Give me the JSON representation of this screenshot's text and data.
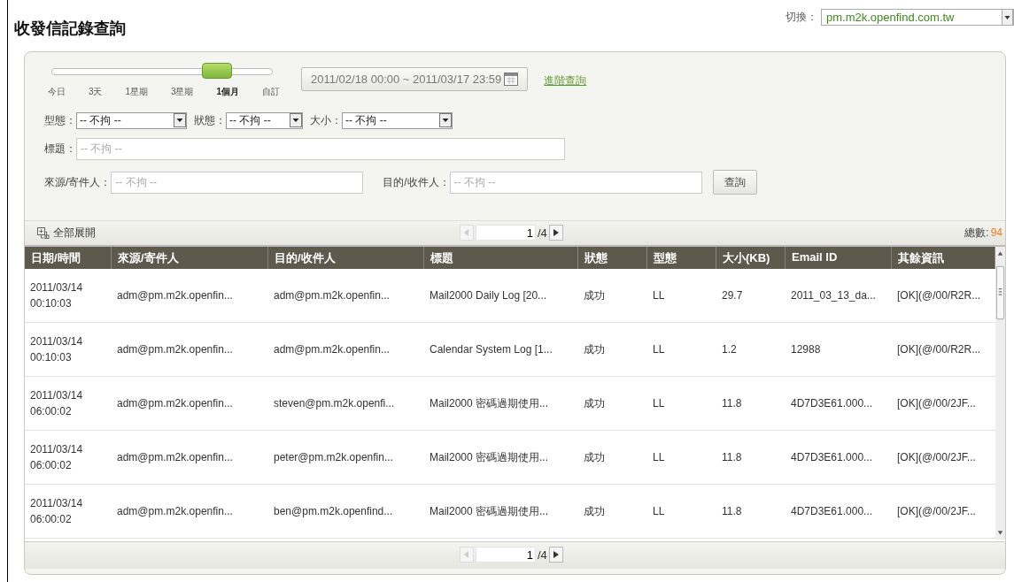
{
  "title": "收發信記錄查詢",
  "switcher": {
    "label": "切換：",
    "value": "pm.m2k.openfind.com.tw"
  },
  "range_slider": {
    "stops": [
      {
        "label": "今日",
        "selected": false
      },
      {
        "label": "3天",
        "selected": false
      },
      {
        "label": "1星期",
        "selected": false
      },
      {
        "label": "3星期",
        "selected": false
      },
      {
        "label": "1個月",
        "selected": true
      },
      {
        "label": "自訂",
        "selected": false
      }
    ]
  },
  "date_range": "2011/02/18 00:00 ~ 2011/03/17 23:59",
  "advanced_link": "進階查詢",
  "filters": [
    {
      "label": "型態：",
      "value": "-- 不拘 --"
    },
    {
      "label": "狀態：",
      "value": "-- 不拘 --"
    },
    {
      "label": "大小：",
      "value": "-- 不拘 --"
    }
  ],
  "subject": {
    "label": "標題：",
    "placeholder": "-- 不拘 --"
  },
  "sender": {
    "label": "來源/寄件人：",
    "placeholder": "-- 不拘 --"
  },
  "recipient": {
    "label": "目的/收件人：",
    "placeholder": "-- 不拘 --"
  },
  "search_button": "查詢",
  "expand_all": "全部展開",
  "pager_top": {
    "page": "1",
    "total": "/4"
  },
  "total": {
    "label": "總數:",
    "value": "94"
  },
  "table": {
    "columns": [
      "日期/時間",
      "來源/寄件人",
      "目的/收件人",
      "標題",
      "狀態",
      "型態",
      "大小(KB)",
      "Email ID",
      "其餘資訊"
    ],
    "rows": [
      [
        "2011/03/14 00:10:03",
        "adm@pm.m2k.openfin...",
        "adm@pm.m2k.openfin...",
        "Mail2000 Daily Log [20...",
        "成功",
        "LL",
        "29.7",
        "2011_03_13_da...",
        "[OK](@/00/R2R..."
      ],
      [
        "2011/03/14 00:10:03",
        "adm@pm.m2k.openfin...",
        "adm@pm.m2k.openfin...",
        "Calendar System Log [1...",
        "成功",
        "LL",
        "1.2",
        "12988",
        "[OK](@/00/R2R..."
      ],
      [
        "2011/03/14 06:00:02",
        "adm@pm.m2k.openfin...",
        "steven@pm.m2k.openfi...",
        "Mail2000 密碼過期使用...",
        "成功",
        "LL",
        "11.8",
        "4D7D3E61.000...",
        "[OK](@/00/2JF..."
      ],
      [
        "2011/03/14 06:00:02",
        "adm@pm.m2k.openfin...",
        "peter@pm.m2k.openfin...",
        "Mail2000 密碼過期使用...",
        "成功",
        "LL",
        "11.8",
        "4D7D3E61.000...",
        "[OK](@/00/2JF..."
      ],
      [
        "2011/03/14 06:00:02",
        "adm@pm.m2k.openfin...",
        "ben@pm.m2k.openfind...",
        "Mail2000 密碼過期使用...",
        "成功",
        "LL",
        "11.8",
        "4D7D3E61.000...",
        "[OK](@/00/2JF..."
      ]
    ]
  },
  "pager_bottom": {
    "page": "1",
    "total": "/4"
  }
}
